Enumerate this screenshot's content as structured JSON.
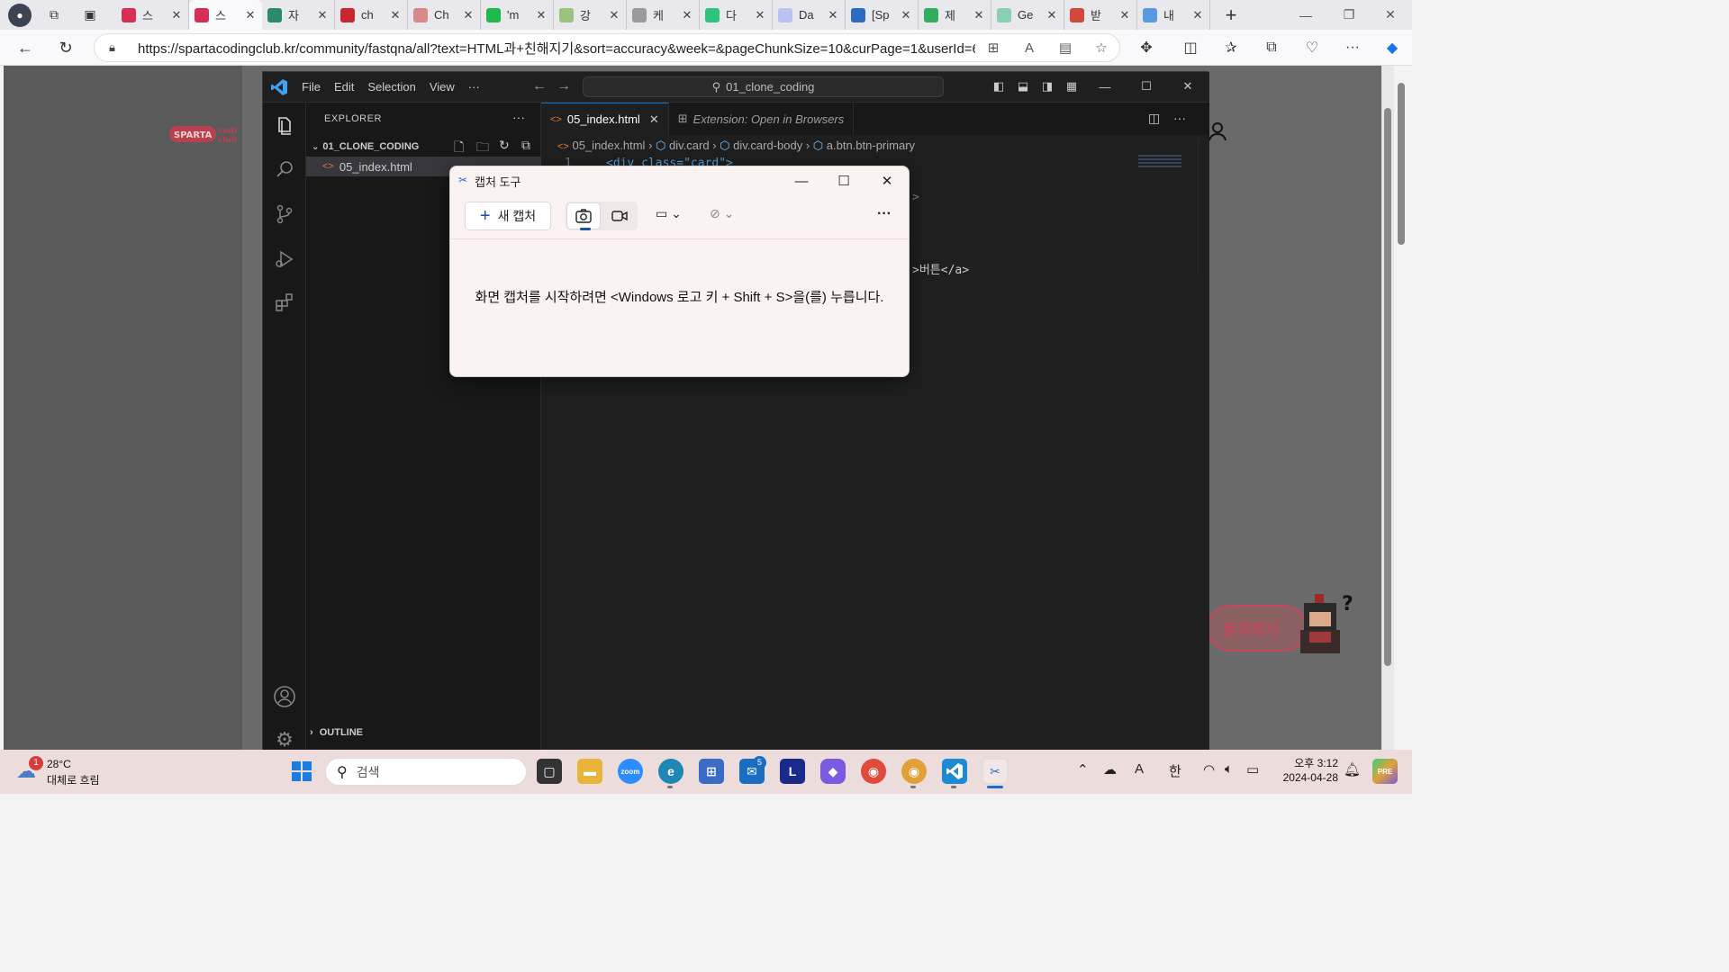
{
  "browser": {
    "tabs": [
      {
        "label": "스",
        "color": "#d62f55"
      },
      {
        "label": "스",
        "color": "#d62f55",
        "active": true
      },
      {
        "label": "자",
        "color": "#2a8a6a"
      },
      {
        "label": "ch",
        "color": "#c9262e"
      },
      {
        "label": "Ch",
        "color": "#d88a8a"
      },
      {
        "label": "'m",
        "color": "#1fb84a"
      },
      {
        "label": "강",
        "color": "#9ac27a"
      },
      {
        "label": "케",
        "color": "#9a9a9a"
      },
      {
        "label": "다",
        "color": "#30c37a"
      },
      {
        "label": "Da",
        "color": "#b8c3f0"
      },
      {
        "label": "[Sp",
        "color": "#2c6bc3"
      },
      {
        "label": "제",
        "color": "#2fae5f"
      },
      {
        "label": "Ge",
        "color": "#8ad0b0"
      },
      {
        "label": "받",
        "color": "#d04a3a"
      },
      {
        "label": "내",
        "color": "#5a9ae0"
      }
    ],
    "new_tab": "+",
    "url": "https://spartacodingclub.kr/community/fastqna/all?text=HTML과+친해지기&sort=accuracy&week=&pageChunkSize=10&curPage=1&userId=6..."
  },
  "page": {
    "logo_text": "SPARTA coding club",
    "qa_button": "문의하기"
  },
  "vscode": {
    "menu": [
      "File",
      "Edit",
      "Selection",
      "View",
      "···"
    ],
    "search": "01_clone_coding",
    "explorer_title": "EXPLORER",
    "explorer_more": "···",
    "folder": "01_CLONE_CODING",
    "file": "05_index.html",
    "outline": "OUTLINE",
    "tabs": [
      {
        "label": "05_index.html",
        "active": true
      },
      {
        "label": "Extension: Open in Browsers",
        "active": false
      }
    ],
    "breadcrumb": {
      "file": "05_index.html",
      "seg1": "div.card",
      "seg2": "div.card-body",
      "seg3": "a.btn.btn-primary"
    },
    "code": {
      "line_number": "1",
      "line1": "<div class=\"card\">",
      "gt": ">",
      "line_btn": ">버튼</a>"
    }
  },
  "snip": {
    "title": "캡처 도구",
    "new_capture": "새 캡처",
    "message": "화면 캡처를 시작하려면 <Windows 로고 키 + Shift + S>을(를) 누릅니다."
  },
  "taskbar": {
    "weather_temp": "28°C",
    "weather_condition": "대체로 흐림",
    "weather_badge": "1",
    "search_placeholder": "검색",
    "mail_badge": "5",
    "ime_a": "A",
    "ime_lang": "한",
    "time": "오후 3:12",
    "date": "2024-04-28"
  }
}
